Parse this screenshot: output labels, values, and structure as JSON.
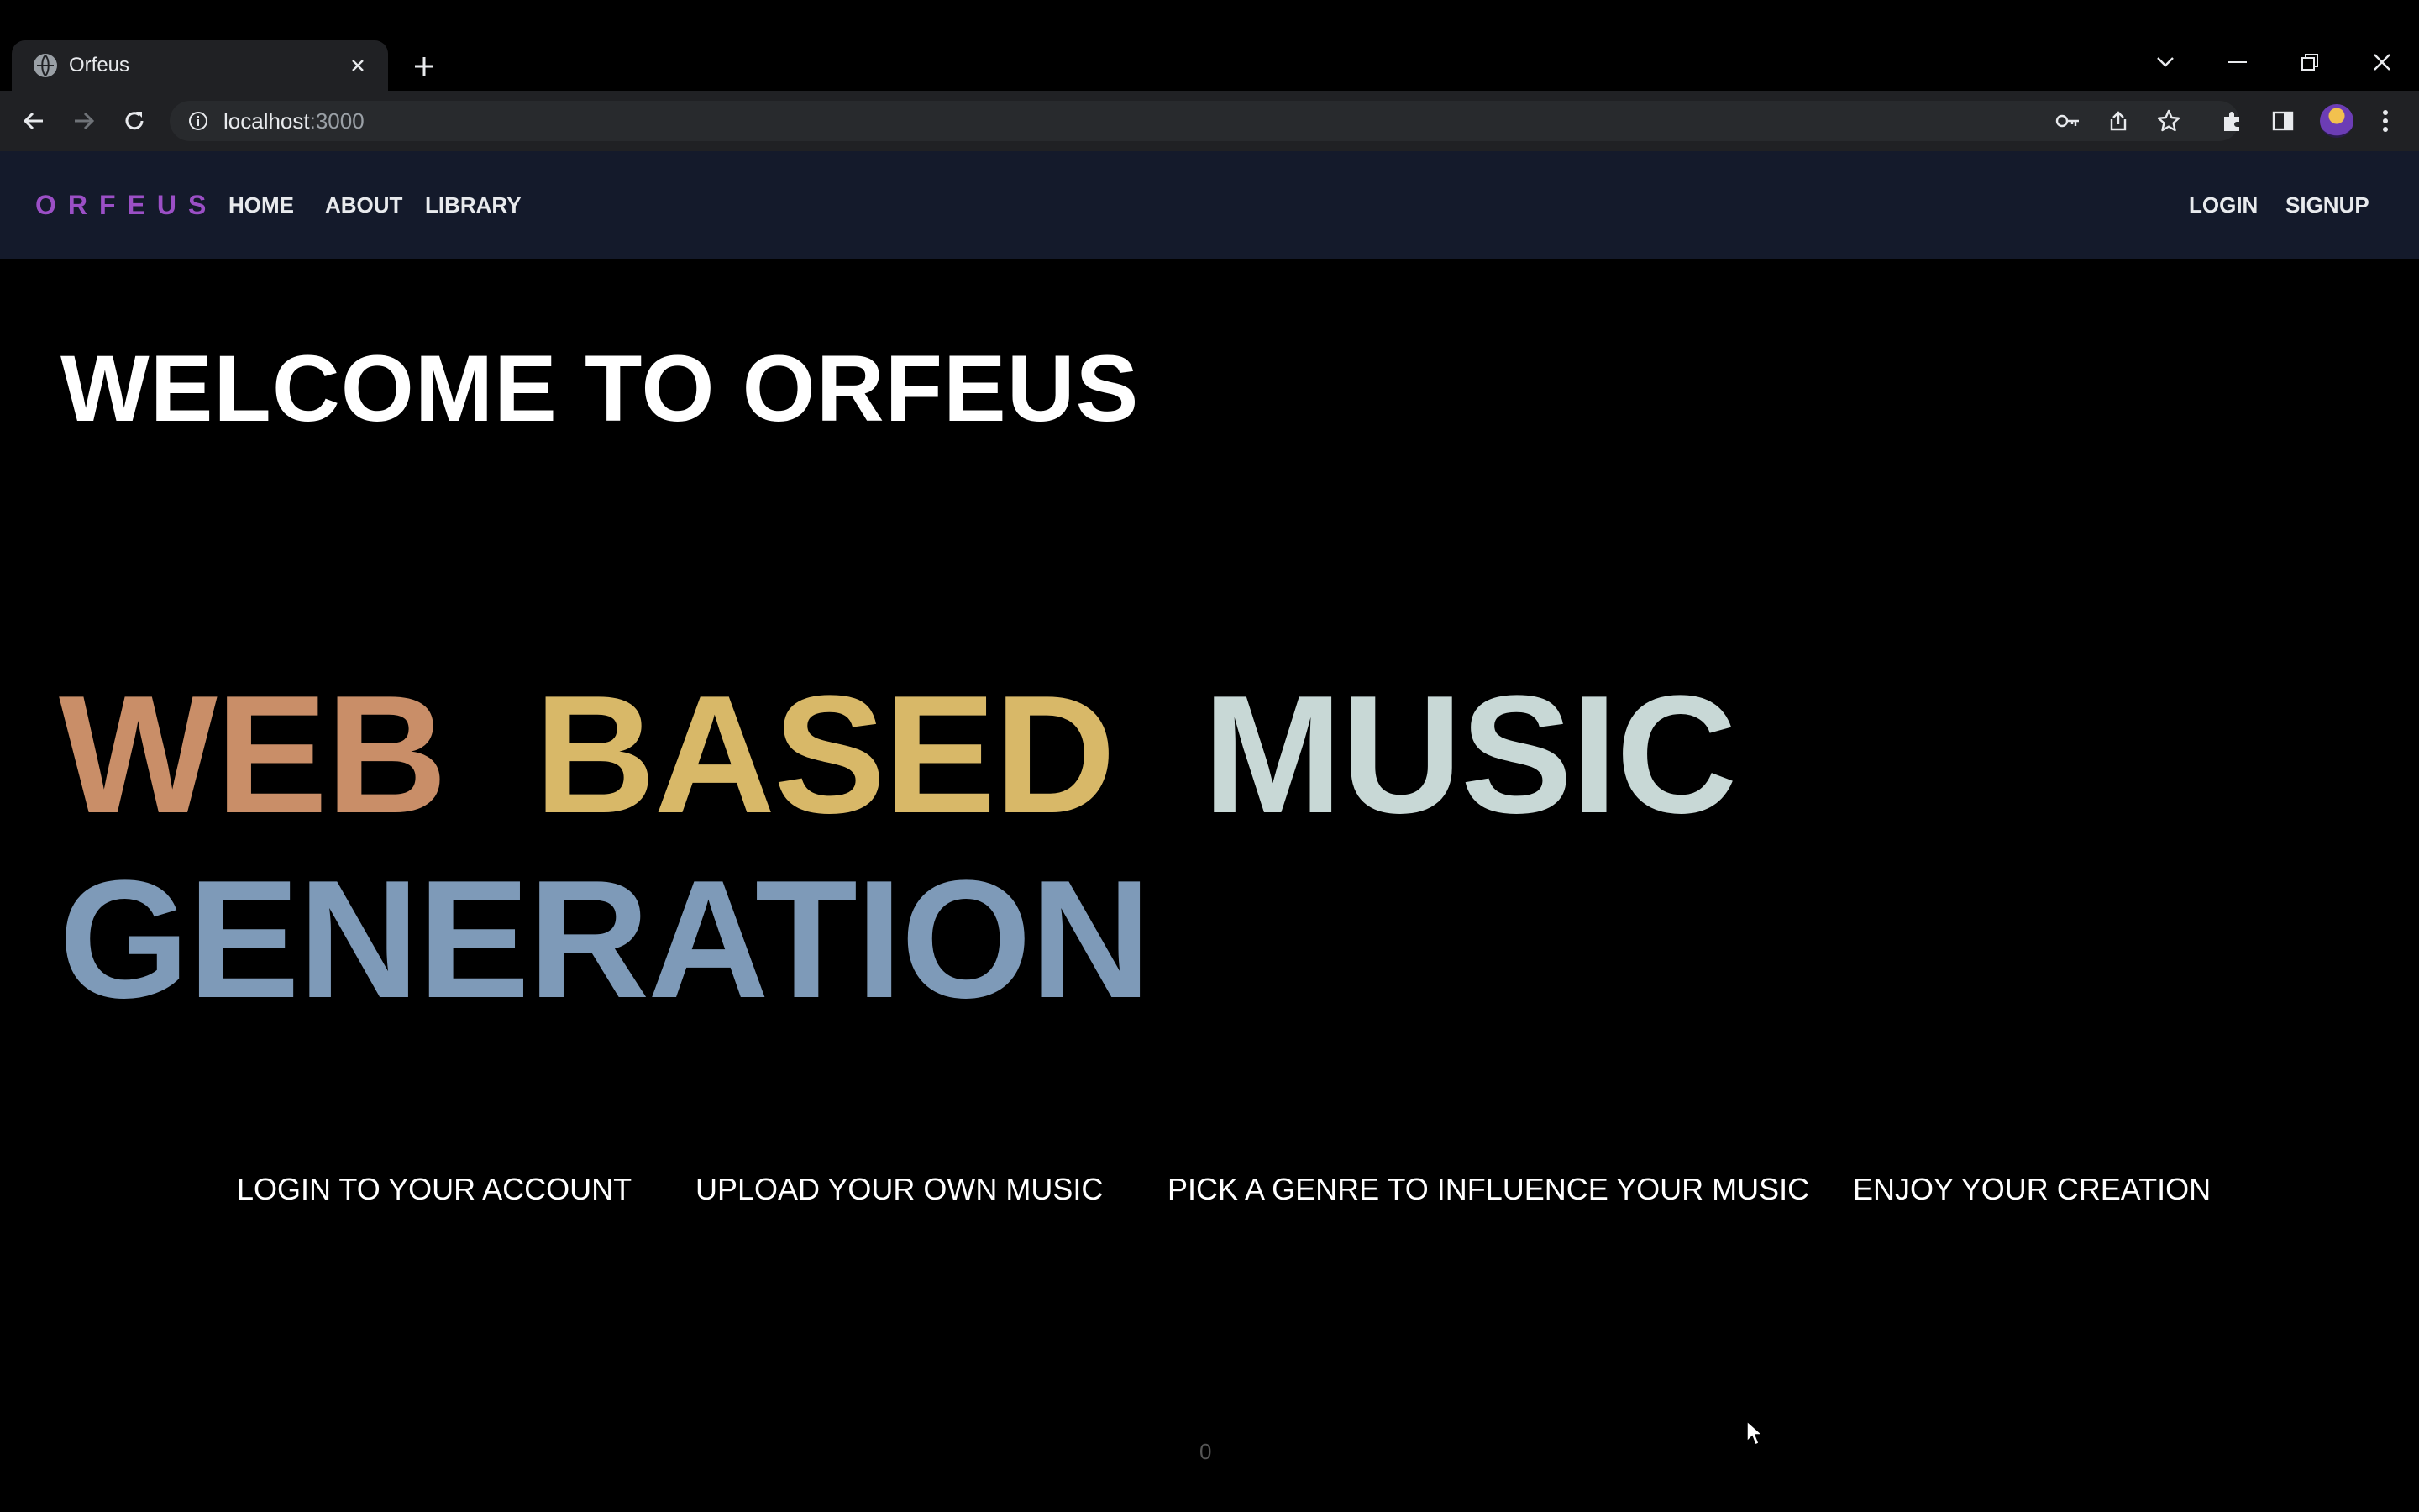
{
  "browser": {
    "tab_title": "Orfeus",
    "url_host": "localhost",
    "url_port": ":3000"
  },
  "app": {
    "brand": "ORFEUS",
    "nav_left": [
      "HOME",
      "ABOUT",
      "LIBRARY"
    ],
    "nav_right": [
      "LOGIN",
      "SIGNUP"
    ],
    "welcome": "WELCOME TO ORFEUS",
    "hero_words": [
      {
        "text": "WEB",
        "color": "#c98e68"
      },
      {
        "text": "BASED",
        "color": "#d8b868"
      },
      {
        "text": "MUSIC",
        "color": "#c8d8d6"
      },
      {
        "text": "GENERATION",
        "color": "#7e9ab8"
      }
    ],
    "steps": [
      "LOGIN TO YOUR ACCOUNT",
      "UPLOAD YOUR OWN MUSIC",
      "PICK A GENRE TO INFLUENCE YOUR MUSIC",
      "ENJOY YOUR CREATION"
    ],
    "counter": "0"
  },
  "colors": {
    "nav_bg": "#141a2b",
    "brand": "#9b4fc6",
    "page_bg": "#000000"
  }
}
